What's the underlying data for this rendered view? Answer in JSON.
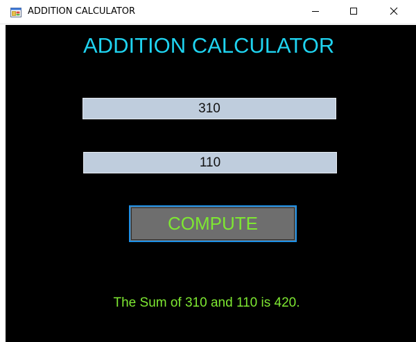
{
  "window": {
    "title": "ADDITION CALCULATOR",
    "icon": "app-form-icon",
    "controls": {
      "minimize": "minimize-icon",
      "maximize": "maximize-icon",
      "close": "close-icon"
    }
  },
  "form": {
    "heading": "ADDITION CALCULATOR",
    "first_number": "310",
    "second_number": "110",
    "compute_label": "COMPUTE",
    "result_text": "The Sum of 310 and 110 is 420."
  },
  "colors": {
    "background": "#000000",
    "heading": "#1fd3f0",
    "accent_green": "#7ee832",
    "field_bg": "#bfcddd",
    "button_bg": "#6e6e6e",
    "button_border": "#1e90e6"
  }
}
